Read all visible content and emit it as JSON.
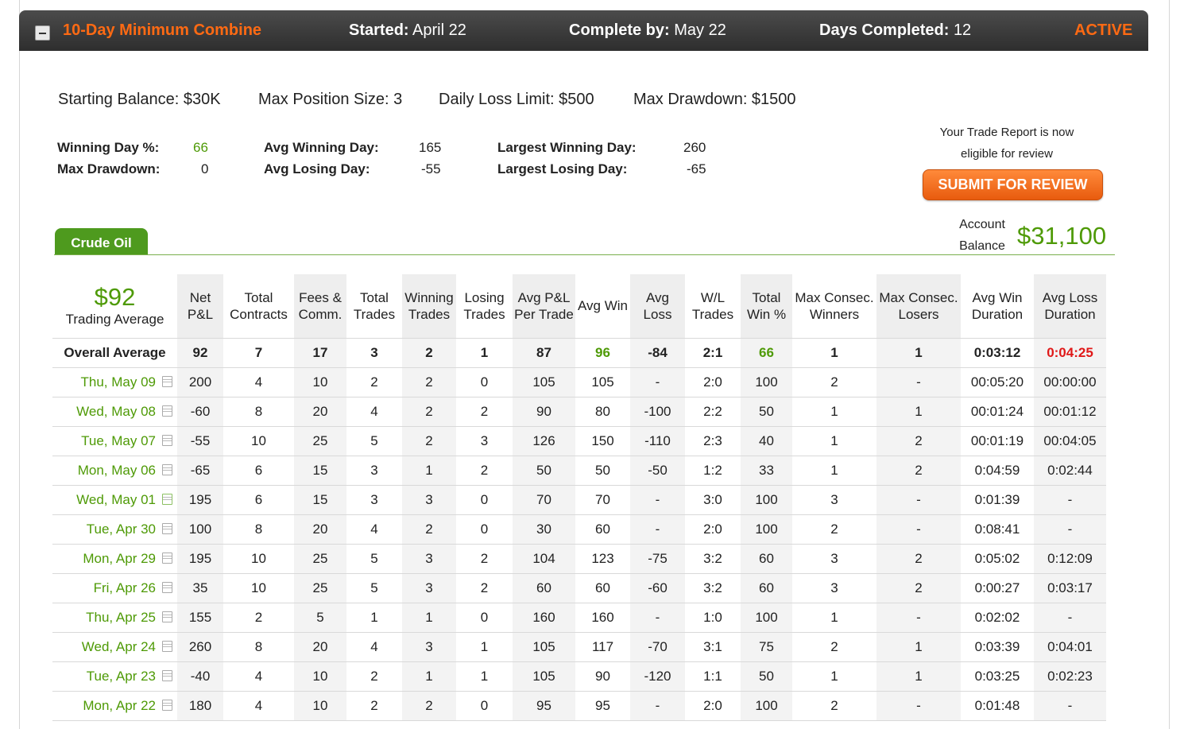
{
  "combine": {
    "title": "10-Day Minimum Combine",
    "started_label": "Started:",
    "started_value": "April 22",
    "complete_label": "Complete by:",
    "complete_value": "May 22",
    "days_label": "Days Completed:",
    "days_value": "12",
    "status": "ACTIVE"
  },
  "rules": {
    "starting_balance": "Starting Balance: $30K",
    "max_position": "Max Position Size: 3",
    "daily_loss": "Daily Loss Limit: $500",
    "max_drawdown": "Max Drawdown: $1500"
  },
  "stats": {
    "winning_day_pct_label": "Winning Day %:",
    "winning_day_pct": "66",
    "max_drawdown_label": "Max Drawdown:",
    "max_drawdown": "0",
    "avg_winning_day_label": "Avg Winning Day:",
    "avg_winning_day": "165",
    "avg_losing_day_label": "Avg Losing Day:",
    "avg_losing_day": "-55",
    "largest_winning_day_label": "Largest Winning Day:",
    "largest_winning_day": "260",
    "largest_losing_day_label": "Largest Losing Day:",
    "largest_losing_day": "-65"
  },
  "review": {
    "line1": "Your Trade Report is now",
    "line2": "eligible for review",
    "button": "SUBMIT FOR REVIEW"
  },
  "account": {
    "label1": "Account",
    "label2": "Balance",
    "value": "$31,100"
  },
  "tab": "Crude Oil",
  "trading_average": {
    "value": "$92",
    "label": "Trading Average"
  },
  "columns": [
    "Net P&L",
    "Total Contracts",
    "Fees & Comm.",
    "Total Trades",
    "Winning Trades",
    "Losing Trades",
    "Avg P&L Per Trade",
    "Avg Win",
    "Avg Loss",
    "W/L Trades",
    "Total Win %",
    "Max Consec. Winners",
    "Max Consec. Losers",
    "Avg Win Duration",
    "Avg Loss Duration"
  ],
  "overall": {
    "label": "Overall Average",
    "values": [
      "92",
      "7",
      "17",
      "3",
      "2",
      "1",
      "87",
      "96",
      "-84",
      "2:1",
      "66",
      "1",
      "1",
      "0:03:12",
      "0:04:25"
    ]
  },
  "rows": [
    {
      "date": "Thu, May 09",
      "values": [
        "200",
        "4",
        "10",
        "2",
        "2",
        "0",
        "105",
        "105",
        "-",
        "2:0",
        "100",
        "2",
        "-",
        "00:05:20",
        "00:00:00"
      ]
    },
    {
      "date": "Wed, May 08",
      "values": [
        "-60",
        "8",
        "20",
        "4",
        "2",
        "2",
        "90",
        "80",
        "-100",
        "2:2",
        "50",
        "1",
        "1",
        "00:01:24",
        "00:01:12"
      ]
    },
    {
      "date": "Tue, May 07",
      "values": [
        "-55",
        "10",
        "25",
        "5",
        "2",
        "3",
        "126",
        "150",
        "-110",
        "2:3",
        "40",
        "1",
        "2",
        "00:01:19",
        "00:04:05"
      ]
    },
    {
      "date": "Mon, May 06",
      "values": [
        "-65",
        "6",
        "15",
        "3",
        "1",
        "2",
        "50",
        "50",
        "-50",
        "1:2",
        "33",
        "1",
        "2",
        "0:04:59",
        "0:02:44"
      ]
    },
    {
      "date": "Wed, May 01",
      "values": [
        "195",
        "6",
        "15",
        "3",
        "3",
        "0",
        "70",
        "70",
        "-",
        "3:0",
        "100",
        "3",
        "-",
        "0:01:39",
        "-"
      ]
    },
    {
      "date": "Tue, Apr 30",
      "values": [
        "100",
        "8",
        "20",
        "4",
        "2",
        "0",
        "30",
        "60",
        "-",
        "2:0",
        "100",
        "2",
        "-",
        "0:08:41",
        "-"
      ]
    },
    {
      "date": "Mon, Apr 29",
      "values": [
        "195",
        "10",
        "25",
        "5",
        "3",
        "2",
        "104",
        "123",
        "-75",
        "3:2",
        "60",
        "3",
        "2",
        "0:05:02",
        "0:12:09"
      ]
    },
    {
      "date": "Fri, Apr 26",
      "values": [
        "35",
        "10",
        "25",
        "5",
        "3",
        "2",
        "60",
        "60",
        "-60",
        "3:2",
        "60",
        "3",
        "2",
        "0:00:27",
        "0:03:17"
      ]
    },
    {
      "date": "Thu, Apr 25",
      "values": [
        "155",
        "2",
        "5",
        "1",
        "1",
        "0",
        "160",
        "160",
        "-",
        "1:0",
        "100",
        "1",
        "-",
        "0:02:02",
        "-"
      ]
    },
    {
      "date": "Wed, Apr 24",
      "values": [
        "260",
        "8",
        "20",
        "4",
        "3",
        "1",
        "105",
        "117",
        "-70",
        "3:1",
        "75",
        "2",
        "1",
        "0:03:39",
        "0:04:01"
      ]
    },
    {
      "date": "Tue, Apr 23",
      "values": [
        "-40",
        "4",
        "10",
        "2",
        "1",
        "1",
        "105",
        "90",
        "-120",
        "1:1",
        "50",
        "1",
        "1",
        "0:03:25",
        "0:02:23"
      ]
    },
    {
      "date": "Mon, Apr 22",
      "values": [
        "180",
        "4",
        "10",
        "2",
        "2",
        "0",
        "95",
        "95",
        "-",
        "2:0",
        "100",
        "2",
        "-",
        "0:01:48",
        "-"
      ]
    }
  ]
}
